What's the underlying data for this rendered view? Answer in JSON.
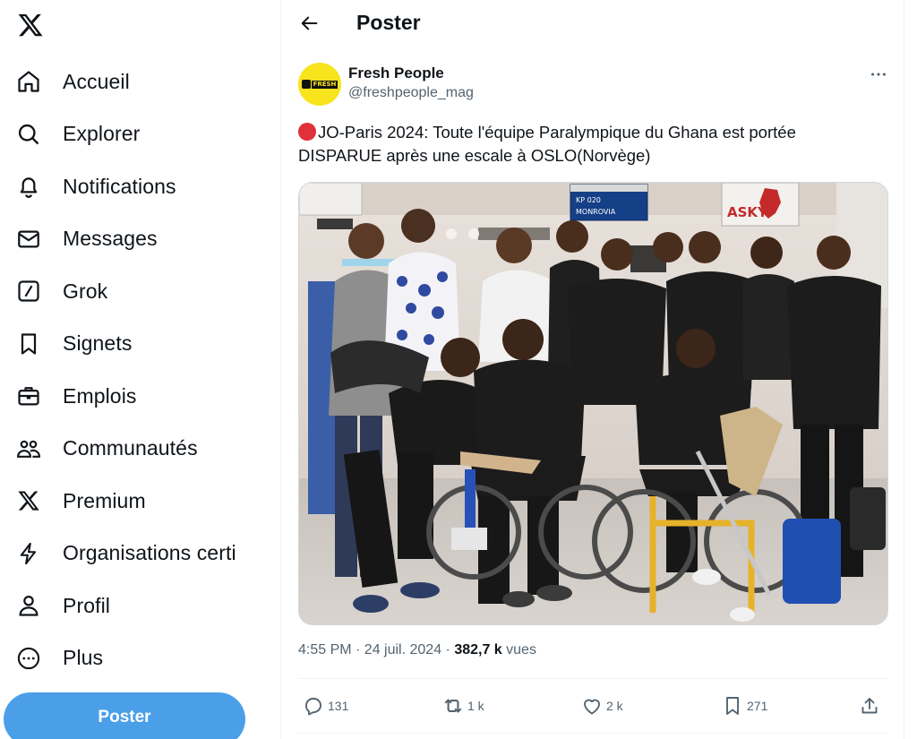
{
  "sidebar": {
    "items": [
      {
        "label": "Accueil",
        "icon": "home-icon"
      },
      {
        "label": "Explorer",
        "icon": "search-icon"
      },
      {
        "label": "Notifications",
        "icon": "bell-icon"
      },
      {
        "label": "Messages",
        "icon": "envelope-icon"
      },
      {
        "label": "Grok",
        "icon": "grok-icon"
      },
      {
        "label": "Signets",
        "icon": "bookmark-icon"
      },
      {
        "label": "Emplois",
        "icon": "briefcase-icon"
      },
      {
        "label": "Communautés",
        "icon": "people-icon"
      },
      {
        "label": "Premium",
        "icon": "x-logo-icon"
      },
      {
        "label": "Organisations certi",
        "icon": "lightning-icon"
      },
      {
        "label": "Profil",
        "icon": "person-icon"
      },
      {
        "label": "Plus",
        "icon": "more-circle-icon"
      }
    ],
    "post_button": "Poster"
  },
  "header": {
    "title": "Poster"
  },
  "tweet": {
    "author_name": "Fresh People",
    "author_handle": "@freshpeople_mag",
    "avatar_text": "FRESH",
    "text": "JO-Paris 2024: Toute l'équipe Paralympique du Ghana est  portée DISPARUE après une escale à OSLO(Norvège)",
    "time": "4:55 PM · 24 juil. 2024 · ",
    "views_count": "382,7 k",
    "views_label": " vues",
    "replies": "131",
    "reposts": "1 k",
    "likes": "2 k",
    "bookmarks": "271",
    "photo_sign_counter": "KP 020",
    "photo_sign_city": "MONROVIA",
    "photo_sign_brand": "ASKY"
  },
  "colors": {
    "accent": "#1d9bf0",
    "post_button": "#4a9fe8",
    "text_secondary": "#536471",
    "red_dot": "#e0303a"
  }
}
